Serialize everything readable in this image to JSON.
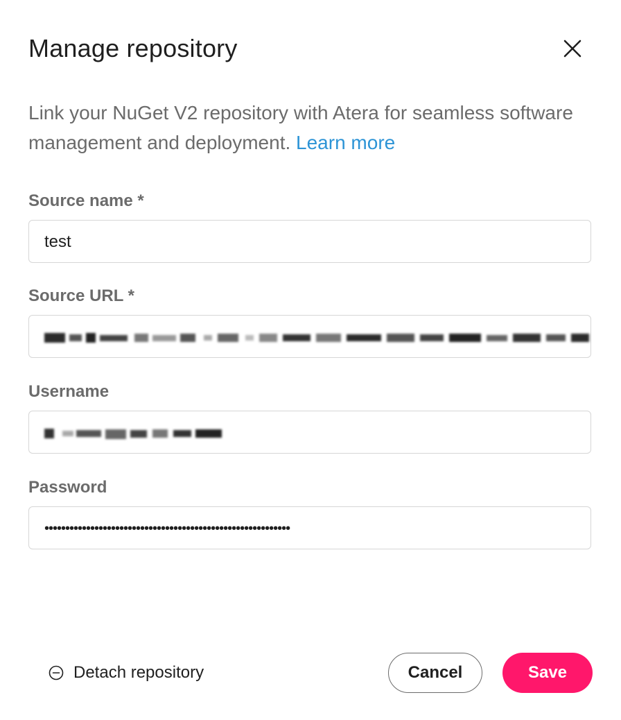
{
  "dialog": {
    "title": "Manage repository",
    "description_text": "Link your NuGet V2 repository with Atera for seamless software management and deployment.",
    "learn_more_label": "Learn more",
    "accent_color": "#ff176b",
    "link_color": "#2d94d6"
  },
  "fields": {
    "source_name": {
      "label": "Source name *",
      "value": "test"
    },
    "source_url": {
      "label": "Source URL *",
      "value_obscured": true
    },
    "username": {
      "label": "Username",
      "value_obscured": true
    },
    "password": {
      "label": "Password",
      "value": "•••••••••••••••••••••••••••••••••••••••••••••••••••••••••••"
    }
  },
  "footer": {
    "detach_label": "Detach repository",
    "cancel_label": "Cancel",
    "save_label": "Save"
  },
  "icons": {
    "close": "close-icon",
    "detach": "minus-circle-icon"
  }
}
